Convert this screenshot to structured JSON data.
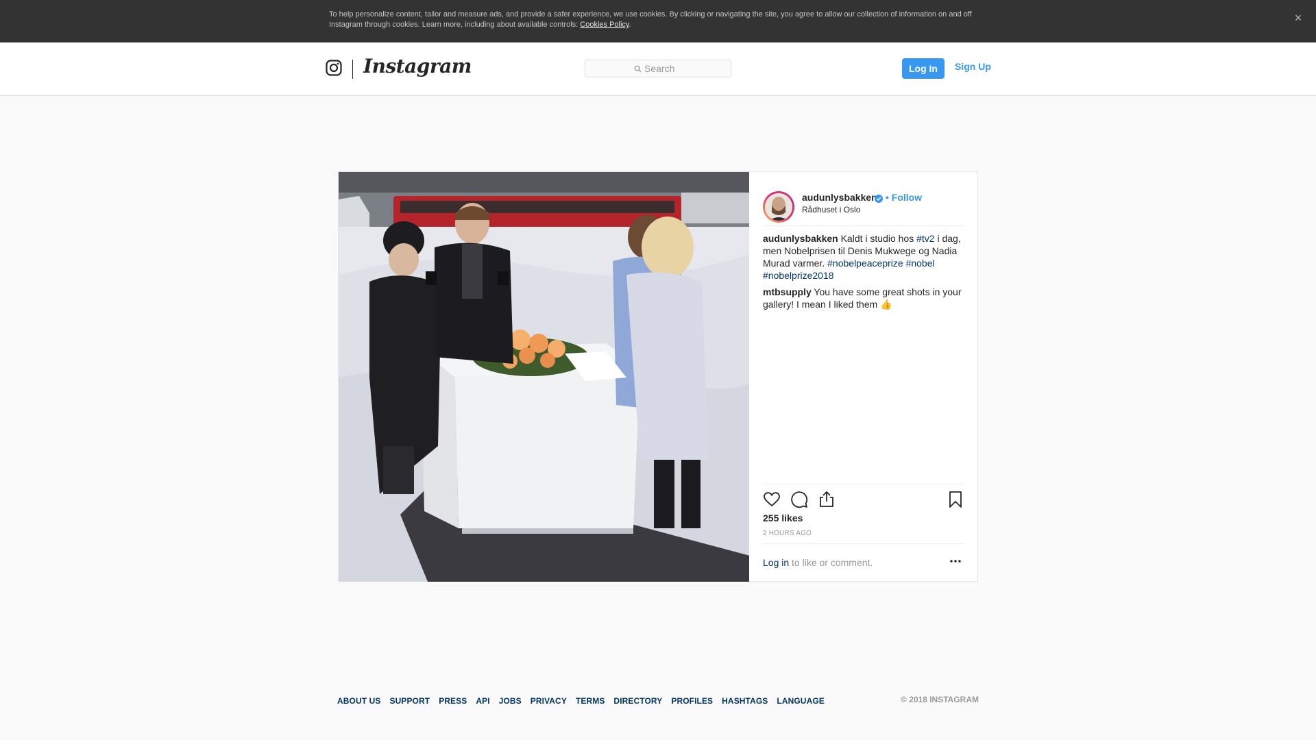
{
  "cookie_banner": {
    "text": "To help personalize content, tailor and measure ads, and provide a safer experience, we use cookies. By clicking or navigating the site, you agree to allow our collection of information on and off Instagram through cookies. Learn more, including about available controls: ",
    "link_label": "Cookies Policy",
    "end": ".",
    "close_symbol": "×"
  },
  "header": {
    "logo_text": "Instagram",
    "search_placeholder": "Search",
    "login_label": "Log In",
    "signup_label": "Sign Up"
  },
  "post": {
    "username": "audunlysbakken",
    "follow_separator": "•",
    "follow_label": "Follow",
    "location": "Rådhuset i Oslo",
    "caption": {
      "user": "audunlysbakken",
      "t1": "Kaldt i studio hos ",
      "tag1": "#tv2",
      "t2": " i dag, men Nobelprisen til Denis Mukwege og Nadia Murad varmer. ",
      "tag2": "#nobelpeaceprize",
      "tag3": "#nobel",
      "tag4": "#nobelprize2018"
    },
    "comment": {
      "user": "mtbsupply",
      "text": "You have some great shots in your gallery! I mean I liked them 👍"
    },
    "likes": "255 likes",
    "time": "2 HOURS AGO",
    "login_prompt_link": "Log in",
    "login_prompt_text": " to like or comment."
  },
  "icons": {
    "like": "heart-icon",
    "comment": "comment-icon",
    "share": "share-icon",
    "save": "bookmark-icon",
    "more": "more-icon",
    "search": "search-icon",
    "logo": "instagram-glyph-icon",
    "verified": "verified-badge-icon"
  },
  "colors": {
    "accent": "#3897f0",
    "link": "#003569",
    "banner": "#333333"
  },
  "footer": {
    "links": [
      "ABOUT US",
      "SUPPORT",
      "PRESS",
      "API",
      "JOBS",
      "PRIVACY",
      "TERMS",
      "DIRECTORY",
      "PROFILES",
      "HASHTAGS",
      "LANGUAGE"
    ],
    "copyright": "© 2018 INSTAGRAM"
  }
}
